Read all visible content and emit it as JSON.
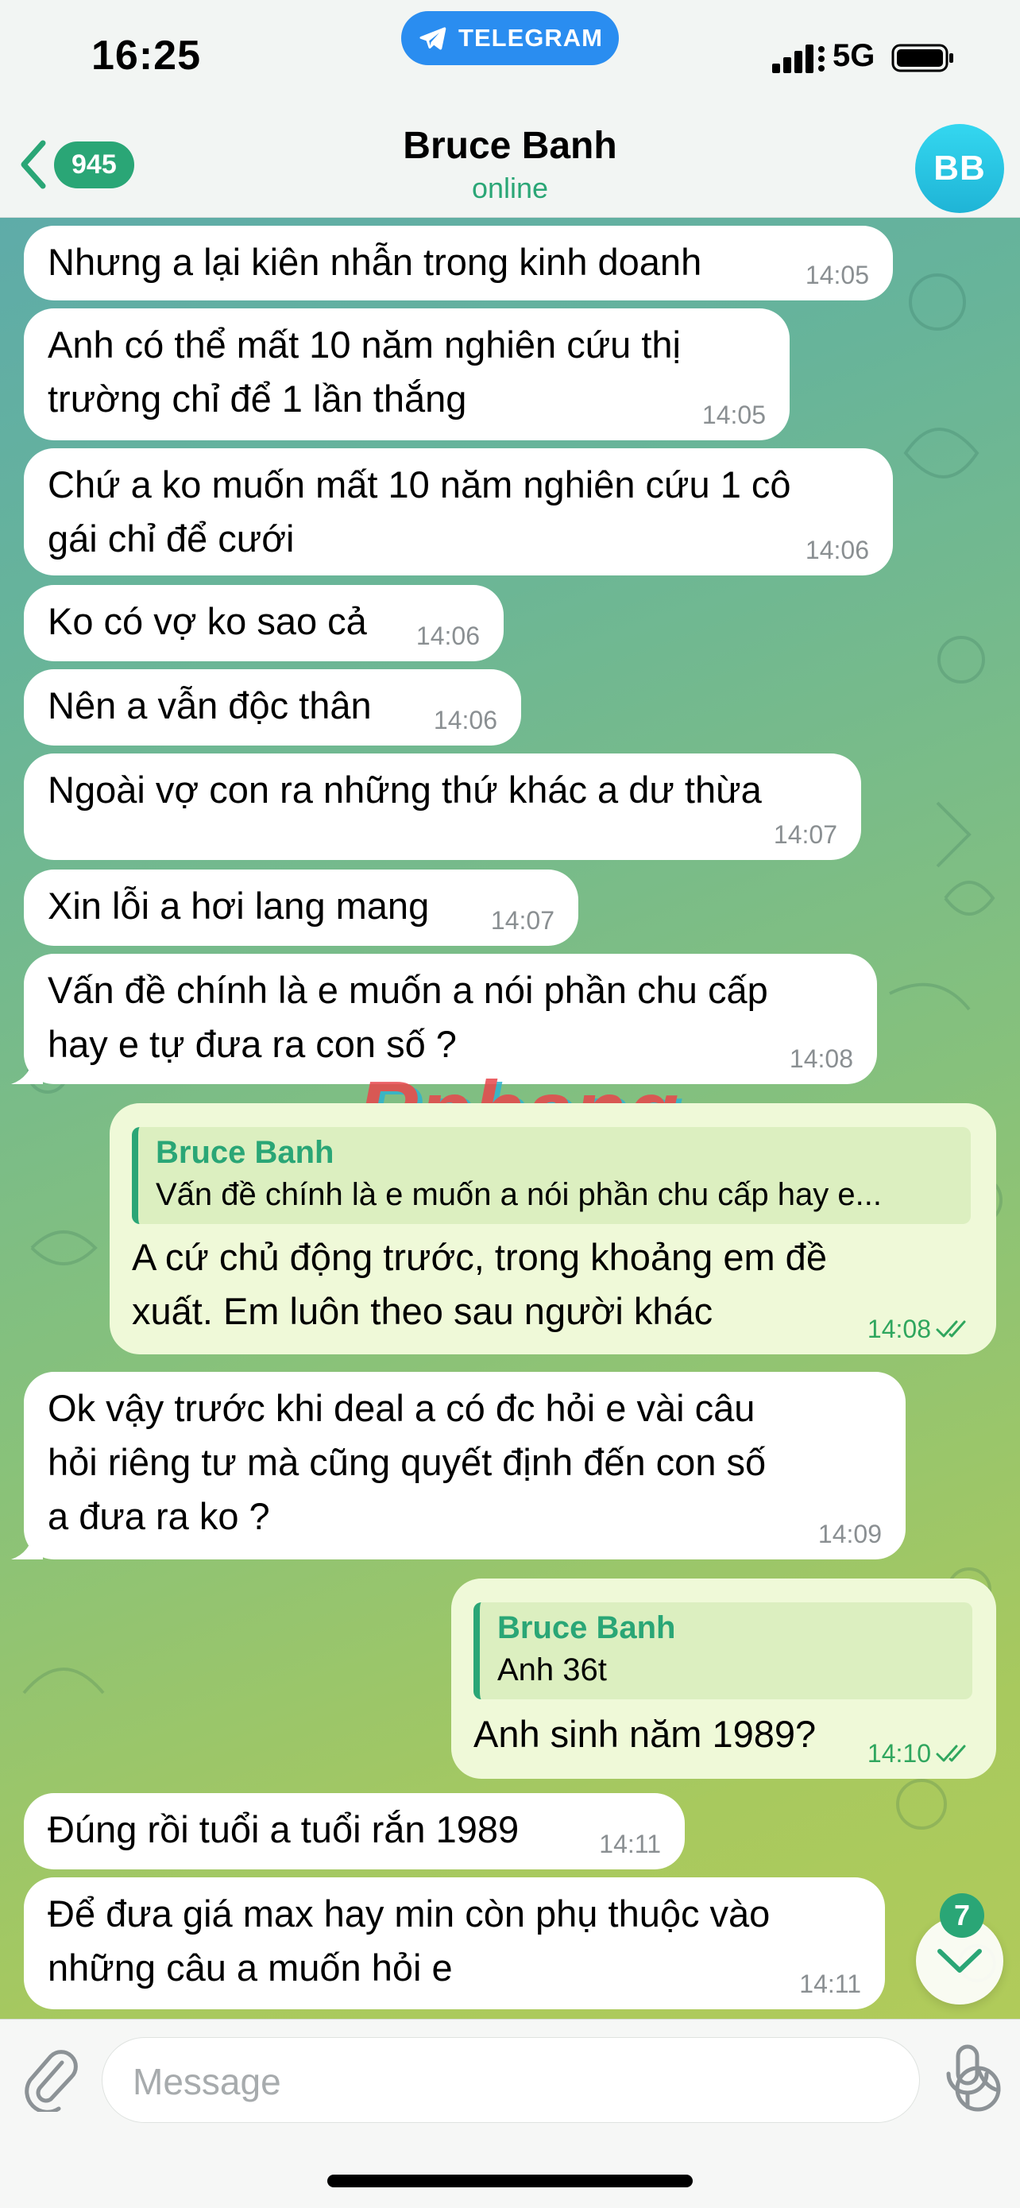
{
  "status_bar": {
    "time": "16:25",
    "app_pill": "TELEGRAM",
    "network": "5G",
    "icons": [
      "telegram-icon",
      "signal-icon",
      "battery-icon"
    ]
  },
  "header": {
    "back_count": "945",
    "title": "Bruce Banh",
    "status": "online",
    "avatar_initials": "BB"
  },
  "messages": [
    {
      "dir": "in",
      "text": "Nhưng a lại kiên nhẫn trong kinh doanh",
      "time": "14:05"
    },
    {
      "dir": "in",
      "text": "Anh có thể mất 10 năm nghiên cứu thị\ntrường chỉ để 1 lần thắng",
      "time": "14:05"
    },
    {
      "dir": "in",
      "text": "Chứ a ko muốn mất 10 năm nghiên cứu 1 cô\ngái chỉ để cưới",
      "time": "14:06"
    },
    {
      "dir": "in",
      "text": "Ko có vợ ko sao cả",
      "time": "14:06"
    },
    {
      "dir": "in",
      "text": "Nên a vẫn độc thân",
      "time": "14:06"
    },
    {
      "dir": "in",
      "text": "Ngoài vợ con ra những thứ khác a dư thừa",
      "time": "14:07"
    },
    {
      "dir": "in",
      "text": "Xin lỗi a hơi lang mang",
      "time": "14:07"
    },
    {
      "dir": "in",
      "text": "Vấn đề chính là e muốn a nói phần chu cấp\nhay e tự đưa ra con số ?",
      "time": "14:08"
    },
    {
      "dir": "out",
      "reply_name": "Bruce Banh",
      "reply_text": "Vấn đề chính là e muốn a nói phần chu cấp hay e...",
      "text": "A cứ chủ động trước, trong khoảng em đề\nxuất. Em luôn theo sau người khác",
      "time": "14:08"
    },
    {
      "dir": "in",
      "text": "Ok vậy trước khi deal a có đc hỏi e vài câu\nhỏi riêng tư mà cũng quyết định đến con số\na đưa ra ko ?",
      "time": "14:09"
    },
    {
      "dir": "out",
      "reply_name": "Bruce Banh",
      "reply_text": "Anh 36t",
      "text": "Anh sinh năm 1989?",
      "time": "14:10"
    },
    {
      "dir": "in",
      "text": "Đúng rồi tuổi a tuổi rắn 1989",
      "time": "14:11"
    },
    {
      "dir": "in",
      "text": "Để đưa giá max hay min còn phụ thuộc vào\nnhững câu a muốn hỏi e",
      "time": "14:11"
    }
  ],
  "watermark": "Rphang",
  "scroll": {
    "unread": "7"
  },
  "composer": {
    "placeholder": "Message"
  }
}
